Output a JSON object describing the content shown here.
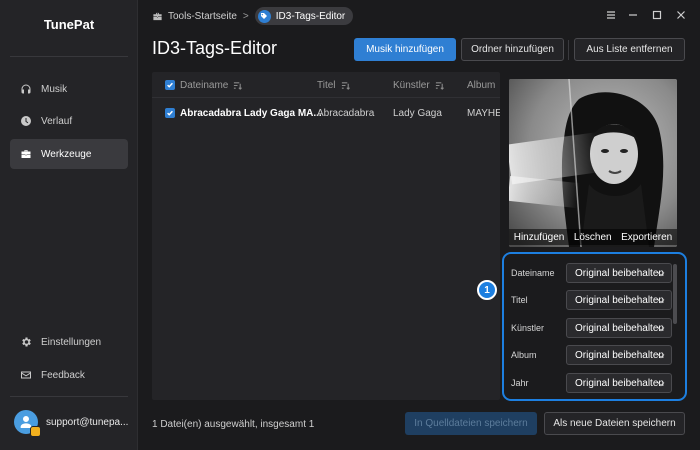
{
  "app": {
    "name": "TunePat"
  },
  "sidebar": {
    "items": [
      {
        "label": "Musik",
        "icon": "headphones-icon"
      },
      {
        "label": "Verlauf",
        "icon": "clock-icon"
      },
      {
        "label": "Werkzeuge",
        "icon": "toolbox-icon",
        "active": true
      }
    ],
    "bottom_items": [
      {
        "label": "Einstellungen",
        "icon": "gear-icon"
      },
      {
        "label": "Feedback",
        "icon": "mail-icon"
      }
    ],
    "user": {
      "email": "support@tunepa..."
    }
  },
  "breadcrumb": {
    "home": "Tools-Startseite",
    "separator": ">",
    "current": "ID3-Tags-Editor"
  },
  "page": {
    "title": "ID3-Tags-Editor"
  },
  "toolbar": {
    "add_music": "Musik hinzufügen",
    "add_folder": "Ordner hinzufügen",
    "remove_from_list": "Aus Liste entfernen"
  },
  "table": {
    "columns": [
      "Dateiname",
      "Titel",
      "Künstler",
      "Album"
    ],
    "rows": [
      {
        "filename": "Abracadabra Lady Gaga MA...",
        "title": "Abracadabra",
        "artist": "Lady Gaga",
        "album": "MAYHE"
      }
    ]
  },
  "cover": {
    "actions": [
      "Hinzufügen",
      "Löschen",
      "Exportieren"
    ]
  },
  "fields": [
    {
      "label": "Dateiname",
      "value": "Original beibehalten"
    },
    {
      "label": "Titel",
      "value": "Original beibehalten"
    },
    {
      "label": "Künstler",
      "value": "Original beibehalten"
    },
    {
      "label": "Album",
      "value": "Original beibehalten"
    },
    {
      "label": "Jahr",
      "value": "Original beibehalten"
    }
  ],
  "callout": {
    "number": "1"
  },
  "footer": {
    "status": "1 Datei(en) ausgewählt, insgesamt 1",
    "save_source": "In Quelldateien speichern",
    "save_new": "Als neue Dateien speichern"
  },
  "colors": {
    "accent": "#2f7fd3",
    "highlight": "#1d7fe0",
    "background": "#1b1b1d",
    "sidebar": "#242427"
  }
}
